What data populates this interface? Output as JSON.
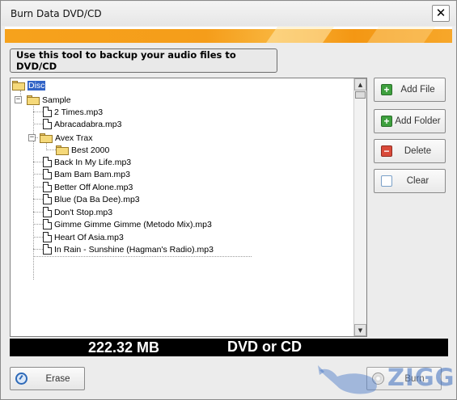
{
  "window": {
    "title": "Burn Data DVD/CD",
    "close_glyph": "✕"
  },
  "banner": {
    "accent": "#F6A21C"
  },
  "tip": "Use this tool to backup your audio files to DVD/CD",
  "tree": {
    "root": "Disc",
    "folder": "Sample",
    "items": [
      {
        "label": "2 Times.mp3",
        "type": "file"
      },
      {
        "label": "Abracadabra.mp3",
        "type": "file"
      },
      {
        "label": "Avex Trax",
        "type": "folder"
      },
      {
        "label": "Best 2000",
        "type": "folder"
      },
      {
        "label": "Back In My Life.mp3",
        "type": "file"
      },
      {
        "label": "Bam Bam Bam.mp3",
        "type": "file"
      },
      {
        "label": "Better Off Alone.mp3",
        "type": "file"
      },
      {
        "label": "Blue (Da Ba Dee).mp3",
        "type": "file"
      },
      {
        "label": "Don't Stop.mp3",
        "type": "file"
      },
      {
        "label": "Gimme Gimme Gimme (Metodo Mix).mp3",
        "type": "file"
      },
      {
        "label": "Heart Of Asia.mp3",
        "type": "file"
      },
      {
        "label": "In Rain - Sunshine (Hagman's Radio).mp3",
        "type": "file"
      }
    ]
  },
  "buttons": {
    "add_file": "Add File",
    "add_folder": "Add Folder",
    "delete": "Delete",
    "clear": "Clear",
    "erase": "Erase",
    "burn": "Burn"
  },
  "status": {
    "size": "222.32 MB",
    "media": "DVD or CD"
  },
  "watermark": {
    "text": "ZIGG"
  }
}
